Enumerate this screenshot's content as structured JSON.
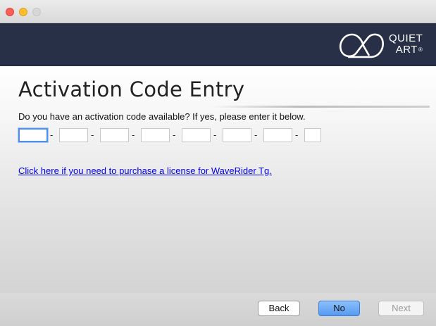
{
  "window": {
    "controls": [
      "close",
      "minimize",
      "zoom"
    ]
  },
  "brand": {
    "logo_icon": "quiet-art-logo-icon",
    "line1": "QUIET",
    "line2": "ART",
    "registered": "®",
    "header_color": "#273046"
  },
  "page": {
    "title": "Activation Code Entry",
    "prompt": "Do you have an activation code available? If yes, please enter it below.",
    "purchase_link": "Click here if you need to purchase a license for WaveRider Tg."
  },
  "code_fields": {
    "count": 8,
    "separator": "-",
    "values": [
      "",
      "",
      "",
      "",
      "",
      "",
      "",
      ""
    ]
  },
  "buttons": {
    "back": "Back",
    "no": "No",
    "next": "Next"
  },
  "colors": {
    "accent": "#5599f1",
    "link": "#0000ee"
  }
}
